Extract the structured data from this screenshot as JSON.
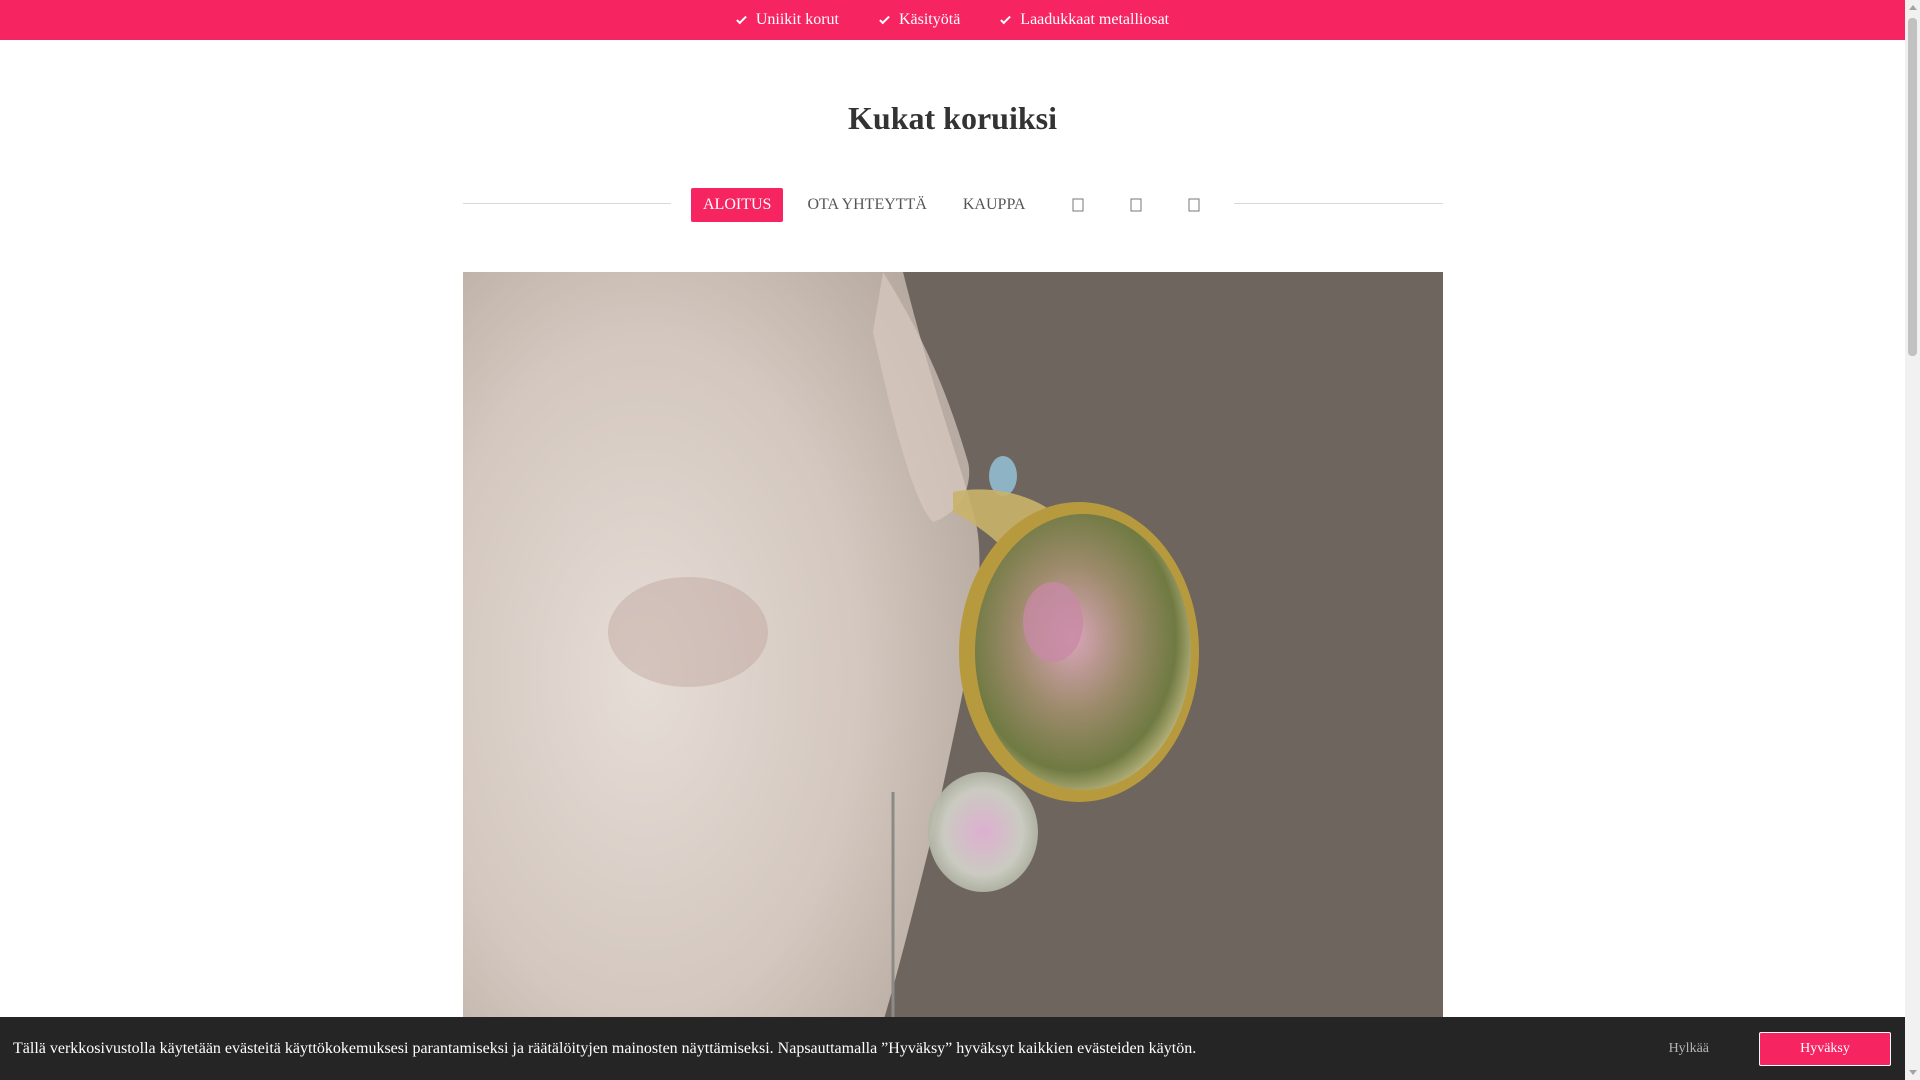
{
  "topbar": {
    "items": [
      {
        "label": "Uniikit korut",
        "icon": "check-icon"
      },
      {
        "label": "Käsityötä",
        "icon": "check-icon"
      },
      {
        "label": "Laadukkaat metalliosat",
        "icon": "check-icon"
      }
    ],
    "color": "#f72462"
  },
  "site": {
    "title": "Kukat koruiksi"
  },
  "nav": {
    "items": [
      {
        "label": "ALOITUS",
        "active": true
      },
      {
        "label": "OTA YHTEYTTÄ",
        "active": false
      },
      {
        "label": "KAUPPA",
        "active": false
      }
    ],
    "icons": [
      "search-icon",
      "user-icon",
      "cart-icon"
    ]
  },
  "hero": {
    "alt": "Close-up of a woman's chin and ear wearing a flower resin earring with gold bezel"
  },
  "cookie": {
    "text": "Tällä verkkosivustolla käytetään evästeitä käyttökokemuksesi parantamiseksi ja räätälöityjen mainosten näyttämiseksi. Napsauttamalla ”Hyväksy” hyväksyt kaikkien evästeiden käytön.",
    "decline": "Hylkää",
    "accept": "Hyväksy"
  }
}
